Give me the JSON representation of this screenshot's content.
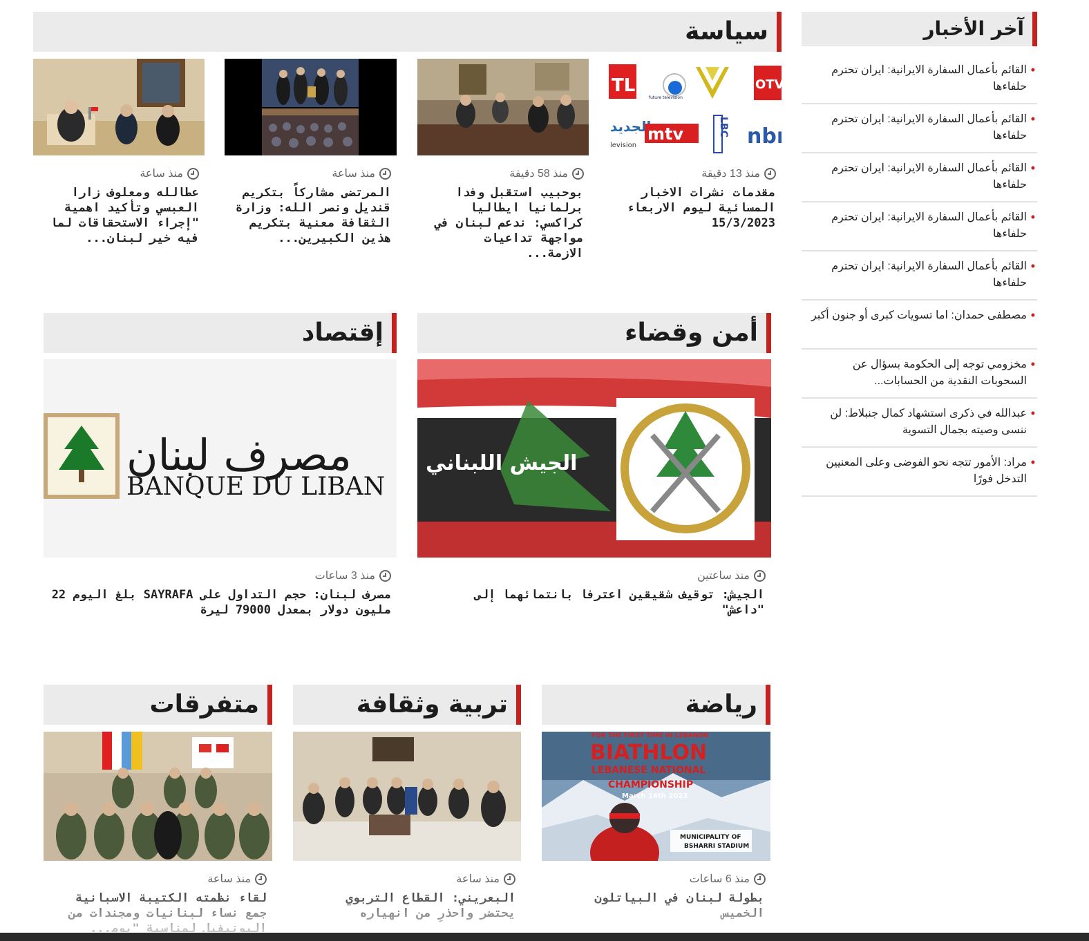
{
  "sections": {
    "politics": {
      "title": "سياسة"
    },
    "security": {
      "title": "أمن وقضاء"
    },
    "economy": {
      "title": "إقتصاد"
    },
    "sports": {
      "title": "رياضة"
    },
    "education": {
      "title": "تربية وثقافة"
    },
    "misc": {
      "title": "متفرقات"
    }
  },
  "politics_articles": [
    {
      "time": "منذ 13 دقيقة",
      "headline": "مقدمات نشرات الاخبار المسائية ليوم الاربعاء 15/3/2023"
    },
    {
      "time": "منذ 58 دقيقة",
      "headline": "بوحبيب استقبل وفدا برلمانيا ايطاليا كراكسي: ندعم لبنان في مواجهة تداعيات الازمة..."
    },
    {
      "time": "منذ ساعة",
      "headline": "المرتضى مشاركاً بتكريم قنديل ونصر الله: وزارة الثقافة معنية بتكريم هذين الكبيرين..."
    },
    {
      "time": "منذ ساعة",
      "headline": "عطالله ومعلوف زارا العبسي وتأكيد اهمية \"إجراء الاستحقاقات لما فيه خير لبنان..."
    }
  ],
  "tv_logos": {
    "otv": "OTV",
    "mtv": "mtv",
    "nbn": "nbn",
    "tl": "TL",
    "lbc": "LBC",
    "future": "future television",
    "aljadeed": "الجديد",
    "aljadeed_sub": "levision"
  },
  "security_article": {
    "time": "منذ ساعتين",
    "headline": "الجيش: توقيف شقيقين اعترفا بانتمائهما إلى \"داعش\"",
    "image_text": "الجيش اللبناني"
  },
  "economy_article": {
    "time": "منذ 3 ساعات",
    "headline": "مصرف لبنان: حجم التداول على SAYRAFA بلغ اليوم 22 مليون دولار بمعدل 79000 ليرة",
    "logo_ar": "مصرف لبنان",
    "logo_fr": "BANQUE DU LIBAN"
  },
  "sports_article": {
    "time": "منذ 6 ساعات",
    "headline": "بطولة لبنان في البياتلون الخميس",
    "poster_top": "FOR THE FIRST TIME IN LEBANON",
    "poster_title": "BIATHLON",
    "poster_sub1": "LEBANESE NATIONAL",
    "poster_sub2": "CHAMPIONSHIP",
    "poster_date": "March 16th 2023",
    "poster_loc1": "MUNICIPALITY OF",
    "poster_loc2": "BSHARRI STADIUM"
  },
  "education_article": {
    "time": "منذ ساعة",
    "headline": "البعريني: القطاع التربوي يحتضر واحذرِ من انهياره"
  },
  "misc_article": {
    "time": "منذ ساعة",
    "headline": "لقاء نظمته الكتيبة الاسبانية جمع نساء لبنانيات ومجندات من اليونيفيل لمناسبة \"يوم..."
  },
  "latest": {
    "title": "آخر الأخبار",
    "items": [
      "القائم بأعمال السفارة الايرانية: ايران تحترم حلفاءها",
      "القائم بأعمال السفارة الايرانية: ايران تحترم حلفاءها",
      "القائم بأعمال السفارة الايرانية: ايران تحترم حلفاءها",
      "القائم بأعمال السفارة الايرانية: ايران تحترم حلفاءها",
      "القائم بأعمال السفارة الايرانية: ايران تحترم حلفاءها",
      "مصطفى حمدان: اما تسويات كبرى أو جنون أكبر",
      "مخزومي توجه إلى الحكومة بسؤال عن السحوبات النقدية من الحسابات...",
      "عبدالله في ذكرى استشهاد كمال جنبلاط: لن ننسى وصيته بجمال التسوية",
      "مراد: الأمور تتجه نحو الفوضى وعلى المعنيين التدخل فورًا"
    ]
  }
}
